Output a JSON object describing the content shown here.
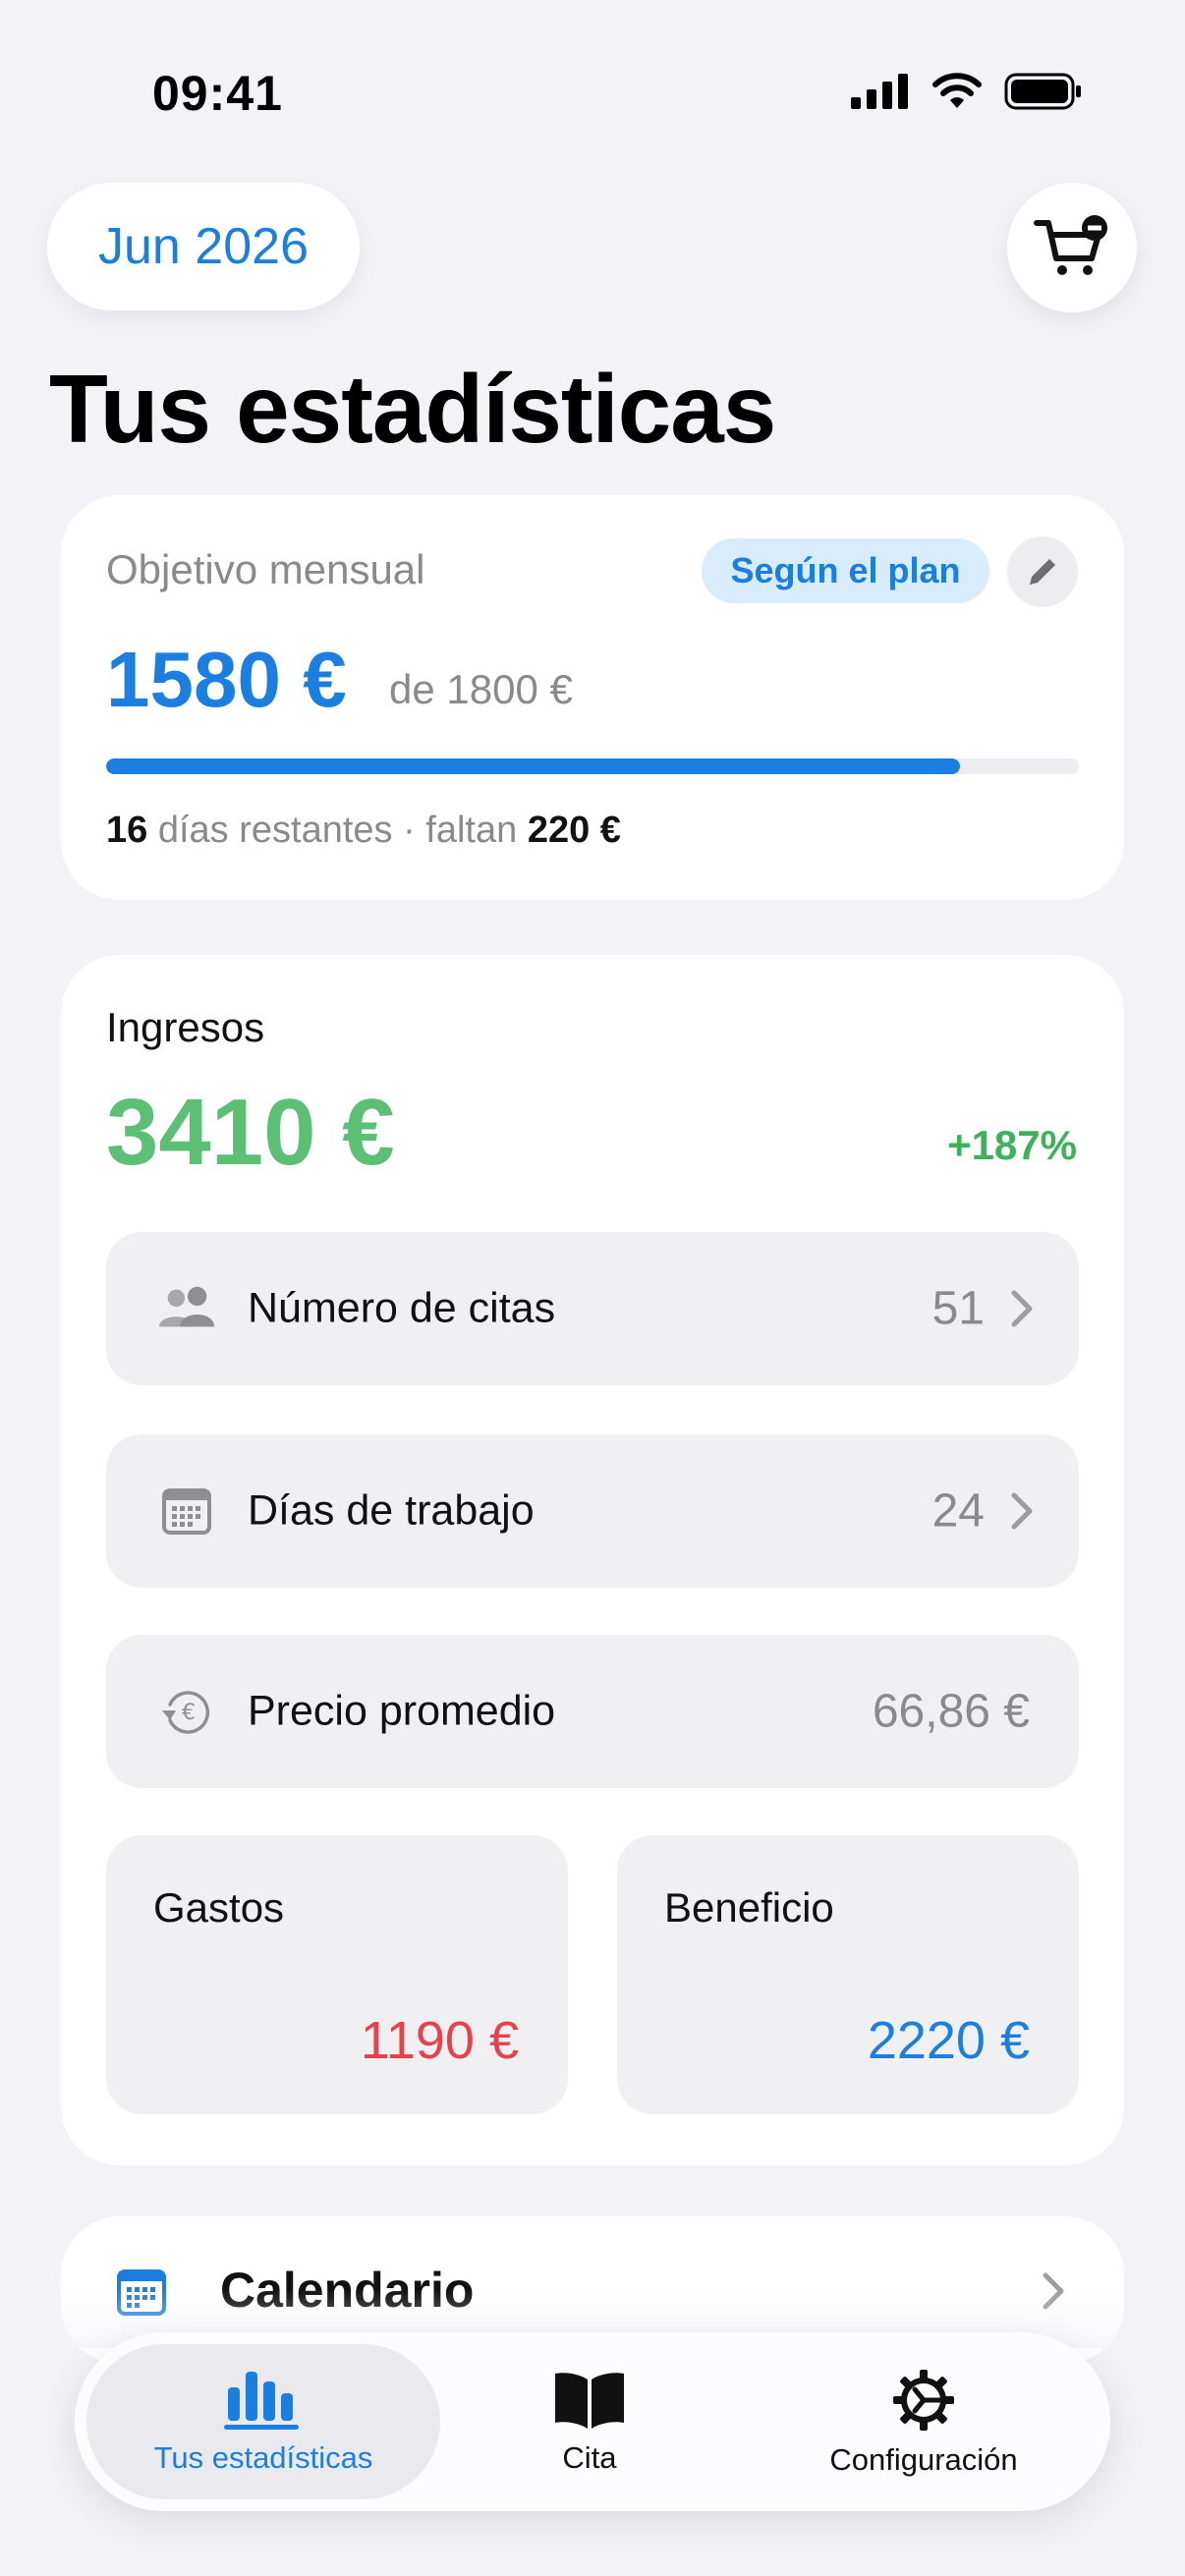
{
  "status_bar": {
    "time": "09:41"
  },
  "header": {
    "month": "Jun 2026",
    "title": "Tus estadísticas",
    "cart_icon": "cart-minus-icon"
  },
  "goal": {
    "label": "Objetivo mensual",
    "badge": "Según el plan",
    "amount": "1580 €",
    "of_text": "de 1800 €",
    "progress": 0.8778,
    "days_left": "16",
    "days_text": "días restantes · faltan",
    "remaining": "220 €",
    "accent": "#1A7FE0"
  },
  "income": {
    "label": "Ingresos",
    "amount": "3410 €",
    "change": "+187%",
    "rows": [
      {
        "icon": "people-icon",
        "label": "Número de citas",
        "value": "51"
      },
      {
        "icon": "calendar-grid-icon",
        "label": "Días de trabajo",
        "value": "24"
      },
      {
        "icon": "euro-history-icon",
        "label": "Precio promedio",
        "value": "66,86 €"
      }
    ],
    "expenses": {
      "label": "Gastos",
      "value": "1190 €",
      "color": "#E8414C"
    },
    "profit": {
      "label": "Beneficio",
      "value": "2220 €",
      "color": "#1A7FE0"
    }
  },
  "calendar": {
    "label": "Calendario"
  },
  "tabs": [
    {
      "label": "Tus estadísticas",
      "icon": "bar-chart-icon",
      "active": true
    },
    {
      "label": "Cita",
      "icon": "book-icon",
      "active": false
    },
    {
      "label": "Configuración",
      "icon": "gear-icon",
      "active": false
    }
  ]
}
